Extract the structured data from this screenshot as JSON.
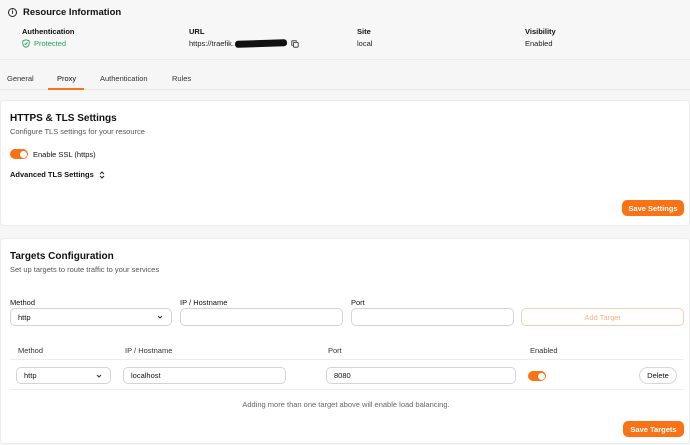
{
  "resource_info": {
    "title": "Resource Information",
    "authentication_label": "Authentication",
    "authentication_value": "Protected",
    "url_label": "URL",
    "url_value": "https://traefik.",
    "site_label": "Site",
    "site_value": "local",
    "visibility_label": "Visibility",
    "visibility_value": "Enabled"
  },
  "tabs": [
    {
      "label": "General"
    },
    {
      "label": "Proxy"
    },
    {
      "label": "Authentication"
    },
    {
      "label": "Rules"
    }
  ],
  "tls": {
    "title": "HTTPS & TLS Settings",
    "subtitle": "Configure TLS settings for your resource",
    "ssl_label": "Enable SSL (https)",
    "ssl_enabled": true,
    "advanced_label": "Advanced TLS Settings",
    "save_label": "Save Settings"
  },
  "targets": {
    "title": "Targets Configuration",
    "subtitle": "Set up targets to route traffic to your services",
    "method_label": "Method",
    "method_value": "http",
    "host_label": "IP / Hostname",
    "host_value": "",
    "port_label": "Port",
    "port_value": "",
    "add_label": "Add Target",
    "table": {
      "headers": [
        "Method",
        "IP / Hostname",
        "Port",
        "Enabled"
      ],
      "rows": [
        {
          "method": "http",
          "host": "localhost",
          "port": "8080",
          "enabled": true,
          "delete_label": "Delete"
        }
      ]
    },
    "note": "Adding more than one target above will enable load balancing.",
    "save_label": "Save Targets"
  },
  "colors": {
    "accent": "#f97316",
    "success": "#22a35a"
  }
}
